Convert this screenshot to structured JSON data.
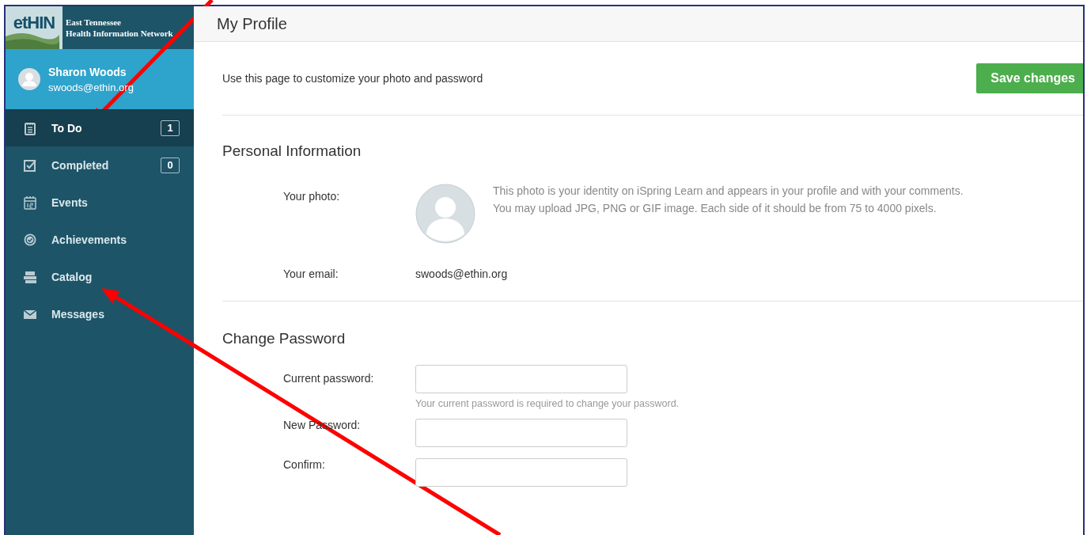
{
  "logo": {
    "mark": "etHIN",
    "lines": [
      "East Tennessee",
      "Health Information Network"
    ]
  },
  "user": {
    "name": "Sharon Woods",
    "email": "swoods@ethin.org"
  },
  "sidebar": {
    "items": [
      {
        "label": "To Do",
        "count": "1",
        "selected": true
      },
      {
        "label": "Completed",
        "count": "0",
        "selected": false
      },
      {
        "label": "Events",
        "selected": false
      },
      {
        "label": "Achievements",
        "selected": false
      },
      {
        "label": "Catalog",
        "selected": false
      },
      {
        "label": "Messages",
        "selected": false
      }
    ]
  },
  "page": {
    "title": "My Profile",
    "intro": "Use this page to customize your photo and password",
    "save_button": "Save changes"
  },
  "personal": {
    "heading": "Personal Information",
    "photo_label": "Your photo:",
    "photo_help": [
      "This photo is your identity on iSpring Learn and appears in your profile and with your comments.",
      "You may upload JPG, PNG or GIF image. Each side of it should be from 75 to 4000 pixels."
    ],
    "email_label": "Your email:",
    "email": "swoods@ethin.org"
  },
  "password": {
    "heading": "Change Password",
    "fields": [
      {
        "label": "Current password:",
        "hint": "Your current password is required to change your password."
      },
      {
        "label": "New Password:"
      },
      {
        "label": "Confirm:"
      }
    ]
  },
  "annotations": [
    {
      "kind": "arrow"
    },
    {
      "kind": "arrow"
    }
  ]
}
